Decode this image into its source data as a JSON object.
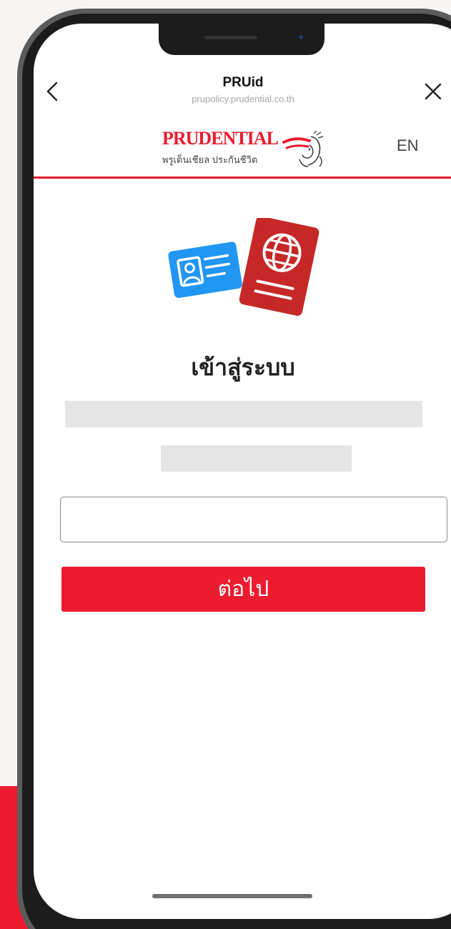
{
  "browser": {
    "title": "PRUid",
    "url": "prupolicy.prudential.co.th",
    "back_icon": "chevron-left-icon",
    "close_icon": "close-icon"
  },
  "brand": {
    "logo_text": "PRUDENTIAL",
    "logo_thai": "พรูเด็นเชียล ประกันชีวิต",
    "brand_color": "#ed1b2e"
  },
  "header": {
    "language_label": "EN"
  },
  "main": {
    "illustration_icon": "id-card-and-passport-icon",
    "heading": "เข้าสู่ระบบ",
    "id_input_value": "",
    "id_input_placeholder": "",
    "next_label": "ต่อไป"
  },
  "colors": {
    "accent": "#ed1b2e",
    "id_card_blue": "#2196f3",
    "passport_red": "#c62828"
  }
}
